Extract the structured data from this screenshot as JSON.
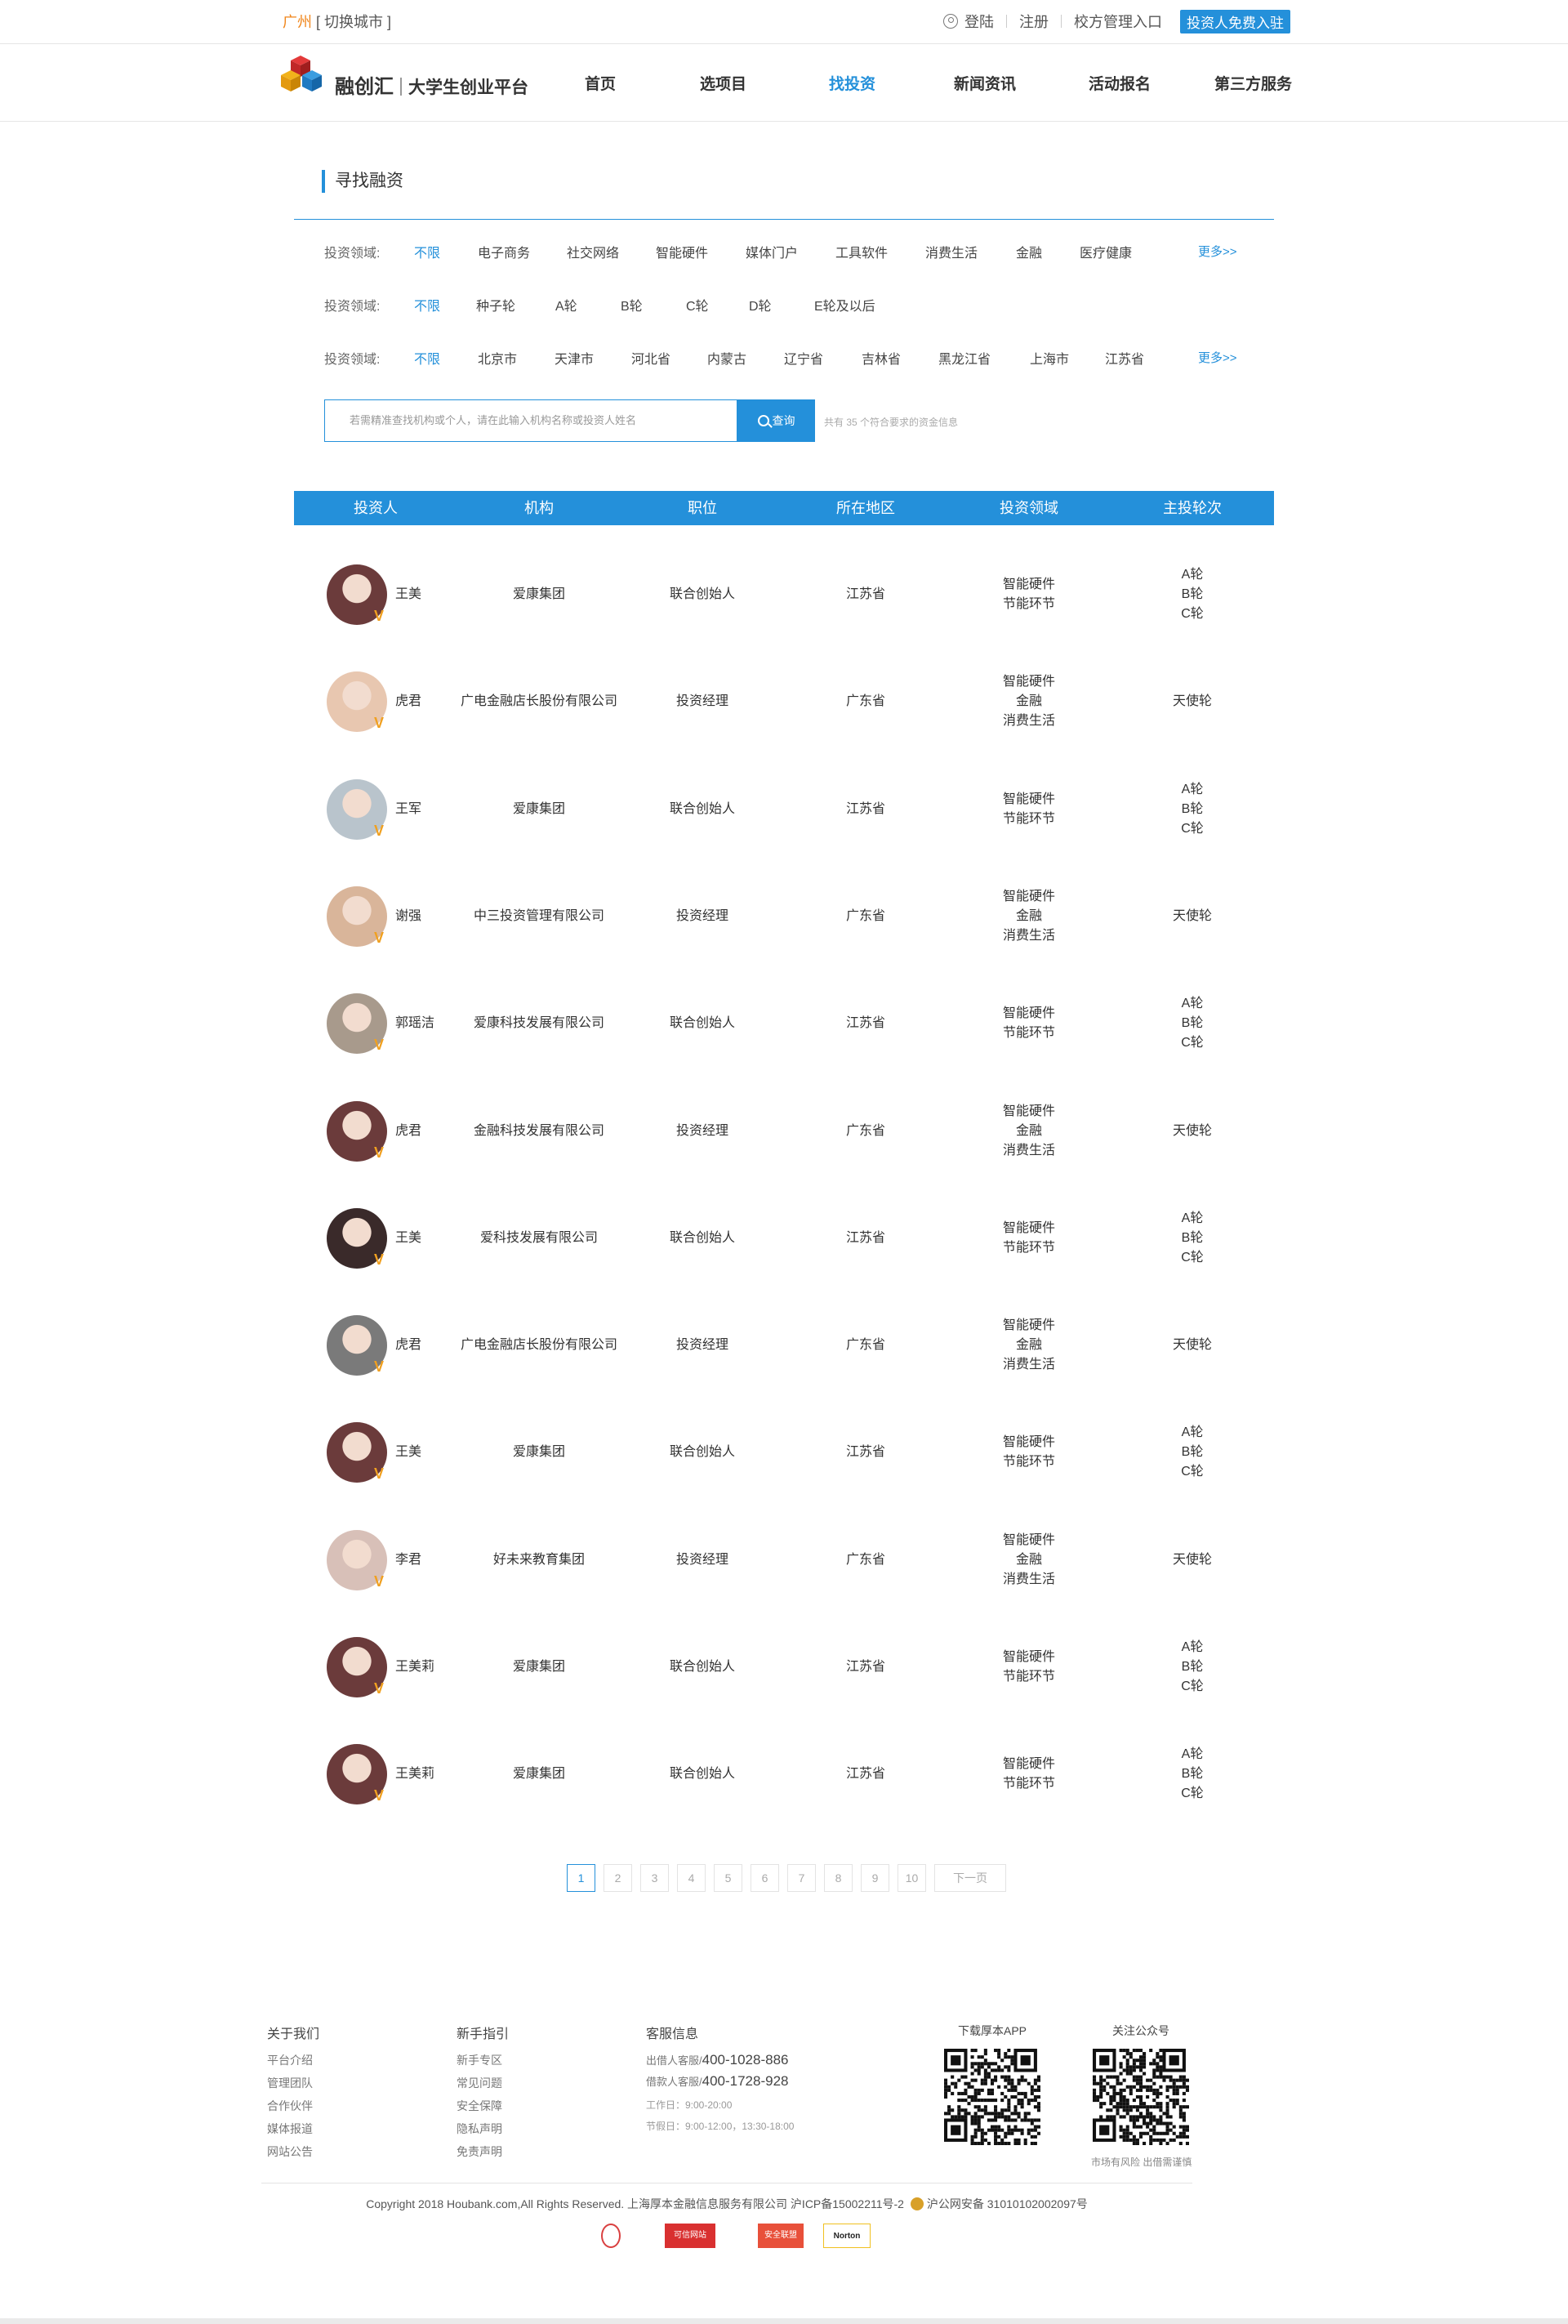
{
  "topbar": {
    "city": "广州",
    "switch_city": "[ 切换城市 ]",
    "login": "登陆",
    "register": "注册",
    "school_entry": "校方管理入口",
    "investor_join": "投资人免费入驻"
  },
  "header": {
    "brand": "融创汇",
    "subtitle": "大学生创业平台",
    "nav": [
      {
        "label": "首页"
      },
      {
        "label": "选项目"
      },
      {
        "label": "找投资"
      },
      {
        "label": "新闻资讯"
      },
      {
        "label": "活动报名"
      },
      {
        "label": "第三方服务"
      }
    ],
    "active_nav": "找投资"
  },
  "section_title": "寻找融资",
  "filters": [
    {
      "label": "投资领域:",
      "options": [
        "不限",
        "电子商务",
        "社交网络",
        "智能硬件",
        "媒体门户",
        "工具软件",
        "消费生活",
        "金融",
        "医疗健康"
      ],
      "selected": "不限",
      "more": "更多>>"
    },
    {
      "label": "投资领域:",
      "options": [
        "不限",
        "种子轮",
        "A轮",
        "B轮",
        "C轮",
        "D轮",
        "E轮及以后"
      ],
      "selected": "不限"
    },
    {
      "label": "投资领域:",
      "options": [
        "不限",
        "北京市",
        "天津市",
        "河北省",
        "内蒙古",
        "辽宁省",
        "吉林省",
        "黑龙江省",
        "上海市",
        "江苏省"
      ],
      "selected": "不限",
      "more": "更多>>"
    }
  ],
  "search": {
    "placeholder": "若需精准查找机构或个人，请在此输入机构名称或投资人姓名",
    "button": "查询",
    "result_count": "共有 35 个符合要求的资金信息"
  },
  "table": {
    "headers": [
      "投资人",
      "机构",
      "职位",
      "所在地区",
      "投资领域",
      "主投轮次"
    ],
    "rows": [
      {
        "name": "王美",
        "org": "爱康集团",
        "position": "联合创始人",
        "region": "江苏省",
        "fields": [
          "智能硬件",
          "节能环节"
        ],
        "rounds": [
          "A轮",
          "B轮",
          "C轮"
        ],
        "avatar_color": "#6b3b3b"
      },
      {
        "name": "虎君",
        "org": "广电金融店长股份有限公司",
        "position": "投资经理",
        "region": "广东省",
        "fields": [
          "智能硬件",
          "金融",
          "消费生活"
        ],
        "rounds": [
          "天使轮"
        ],
        "avatar_color": "#e8c7b0"
      },
      {
        "name": "王军",
        "org": "爱康集团",
        "position": "联合创始人",
        "region": "江苏省",
        "fields": [
          "智能硬件",
          "节能环节"
        ],
        "rounds": [
          "A轮",
          "B轮",
          "C轮"
        ],
        "avatar_color": "#b9c4cc"
      },
      {
        "name": "谢强",
        "org": "中三投资管理有限公司",
        "position": "投资经理",
        "region": "广东省",
        "fields": [
          "智能硬件",
          "金融",
          "消费生活"
        ],
        "rounds": [
          "天使轮"
        ],
        "avatar_color": "#d9b59a"
      },
      {
        "name": "郭瑶洁",
        "org": "爱康科技发展有限公司",
        "position": "联合创始人",
        "region": "江苏省",
        "fields": [
          "智能硬件",
          "节能环节"
        ],
        "rounds": [
          "A轮",
          "B轮",
          "C轮"
        ],
        "avatar_color": "#a89a8c"
      },
      {
        "name": "虎君",
        "org": "金融科技发展有限公司",
        "position": "投资经理",
        "region": "广东省",
        "fields": [
          "智能硬件",
          "金融",
          "消费生活"
        ],
        "rounds": [
          "天使轮"
        ],
        "avatar_color": "#6b3b3b"
      },
      {
        "name": "王美",
        "org": "爱科技发展有限公司",
        "position": "联合创始人",
        "region": "江苏省",
        "fields": [
          "智能硬件",
          "节能环节"
        ],
        "rounds": [
          "A轮",
          "B轮",
          "C轮"
        ],
        "avatar_color": "#3a2a2a"
      },
      {
        "name": "虎君",
        "org": "广电金融店长股份有限公司",
        "position": "投资经理",
        "region": "广东省",
        "fields": [
          "智能硬件",
          "金融",
          "消费生活"
        ],
        "rounds": [
          "天使轮"
        ],
        "avatar_color": "#7a7a7a"
      },
      {
        "name": "王美",
        "org": "爱康集团",
        "position": "联合创始人",
        "region": "江苏省",
        "fields": [
          "智能硬件",
          "节能环节"
        ],
        "rounds": [
          "A轮",
          "B轮",
          "C轮"
        ],
        "avatar_color": "#6b3b3b"
      },
      {
        "name": "李君",
        "org": "好未来教育集团",
        "position": "投资经理",
        "region": "广东省",
        "fields": [
          "智能硬件",
          "金融",
          "消费生活"
        ],
        "rounds": [
          "天使轮"
        ],
        "avatar_color": "#d8c0b8"
      },
      {
        "name": "王美莉",
        "org": "爱康集团",
        "position": "联合创始人",
        "region": "江苏省",
        "fields": [
          "智能硬件",
          "节能环节"
        ],
        "rounds": [
          "A轮",
          "B轮",
          "C轮"
        ],
        "avatar_color": "#6b3b3b"
      },
      {
        "name": "王美莉",
        "org": "爱康集团",
        "position": "联合创始人",
        "region": "江苏省",
        "fields": [
          "智能硬件",
          "节能环节"
        ],
        "rounds": [
          "A轮",
          "B轮",
          "C轮"
        ],
        "avatar_color": "#6b3b3b"
      }
    ]
  },
  "pagination": {
    "pages": [
      "1",
      "2",
      "3",
      "4",
      "5",
      "6",
      "7",
      "8",
      "9",
      "10"
    ],
    "current": "1",
    "next": "下一页"
  },
  "footer": {
    "about": {
      "title": "关于我们",
      "links": [
        "平台介绍",
        "管理团队",
        "合作伙伴",
        "媒体报道",
        "网站公告"
      ]
    },
    "guide": {
      "title": "新手指引",
      "links": [
        "新手专区",
        "常见问题",
        "安全保障",
        "隐私声明",
        "免责声明"
      ]
    },
    "service": {
      "title": "客服信息",
      "invest_label": "出借人客服/",
      "invest_phone": "400-1028-886",
      "borrow_label": "借款人客服/",
      "borrow_phone": "400-1728-928",
      "workday": "工作日：9:00-20:00",
      "holiday": "节假日：9:00-12:00，13:30-18:00"
    },
    "app_title": "下载厚本APP",
    "wechat_title": "关注公众号",
    "risk_note": "市场有风险 出借需谨慎",
    "copyright": "Copyright 2018 Houbank.com,All Rights Reserved.  上海厚本金融信息服务有限公司    沪ICP备15002211号-2",
    "police": "沪公网安备 31010102002097号",
    "badges": [
      "可信网站",
      "安全联盟",
      "Norton"
    ]
  },
  "colors": {
    "accent": "#2490da",
    "city": "#f08519",
    "badge": "#f0a020"
  }
}
